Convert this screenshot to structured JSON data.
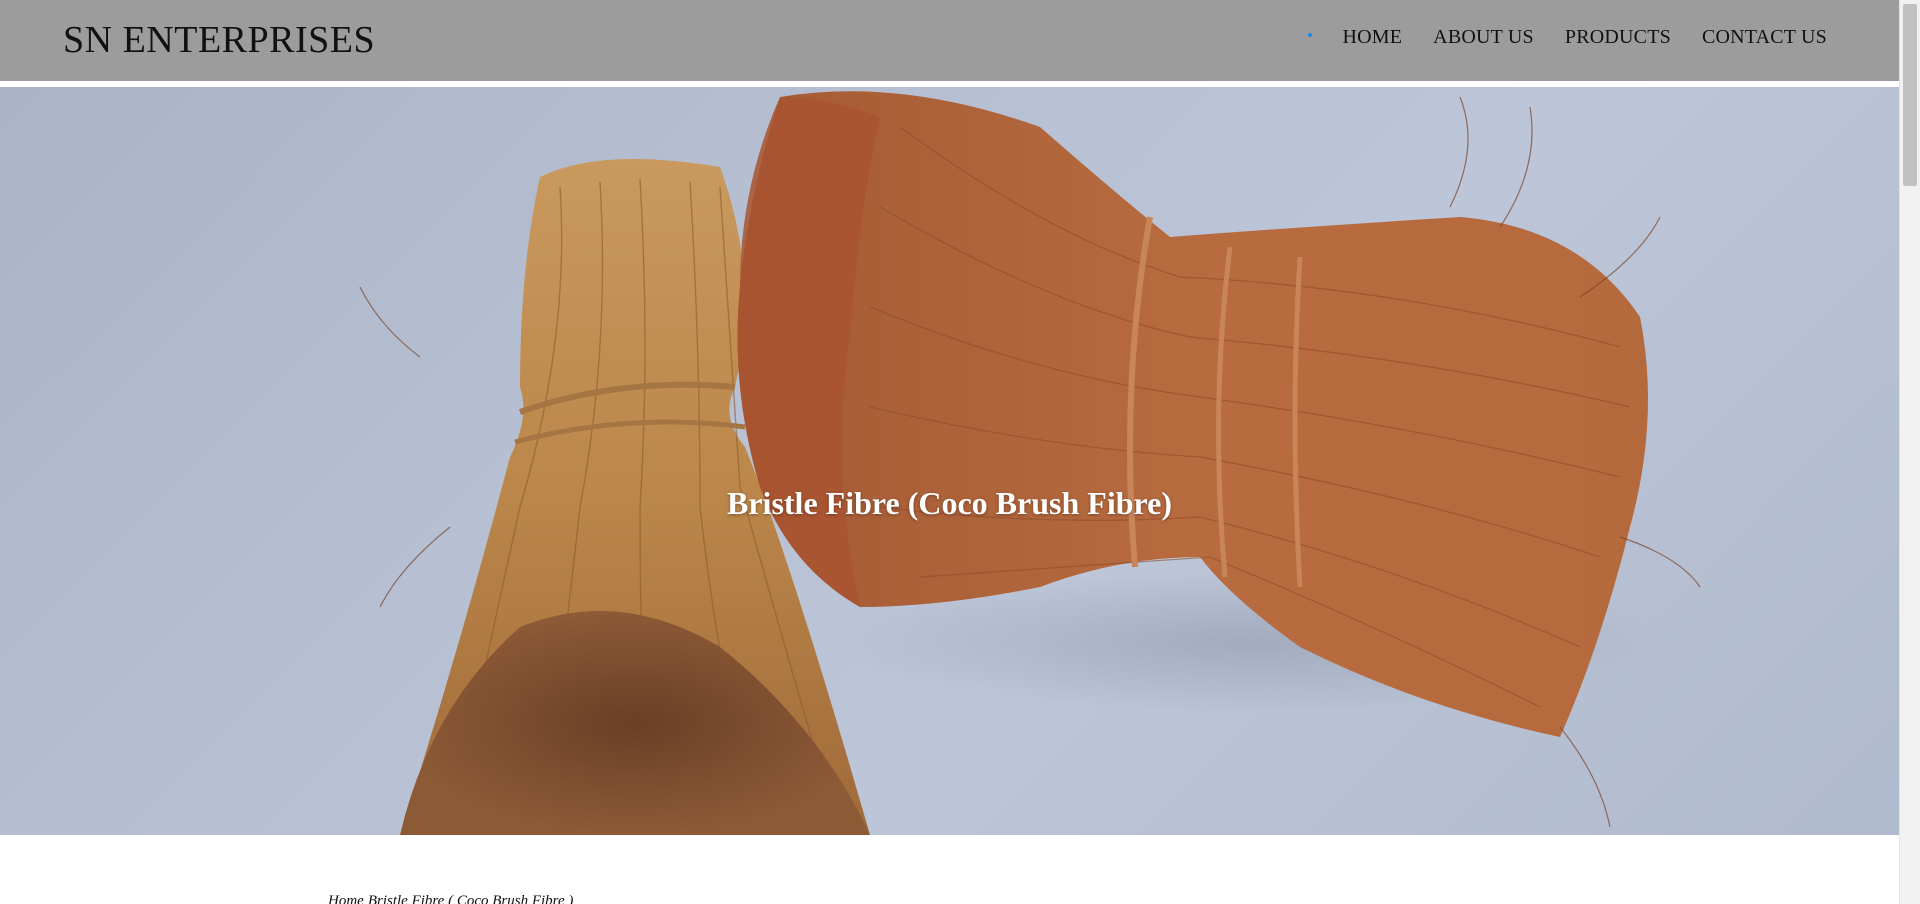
{
  "header": {
    "brand": "SN ENTERPRISES",
    "nav": [
      {
        "label": "HOME"
      },
      {
        "label": "ABOUT US"
      },
      {
        "label": "PRODUCTS"
      },
      {
        "label": "CONTACT US"
      }
    ]
  },
  "hero": {
    "title": "Bristle Fibre (Coco Brush Fibre)",
    "image": "coco-brush-fibre-bundles-photo"
  },
  "breadcrumb": {
    "home": "Home",
    "current": "Bristle Fibre ( Coco Brush Fibre )"
  },
  "colors": {
    "header_bg": "#9c9c9c",
    "nav_dot": "#1e88e5",
    "hero_bg": "#b6c0d2",
    "fibre_light": "#c08a4e",
    "fibre_dark": "#9a5530"
  }
}
